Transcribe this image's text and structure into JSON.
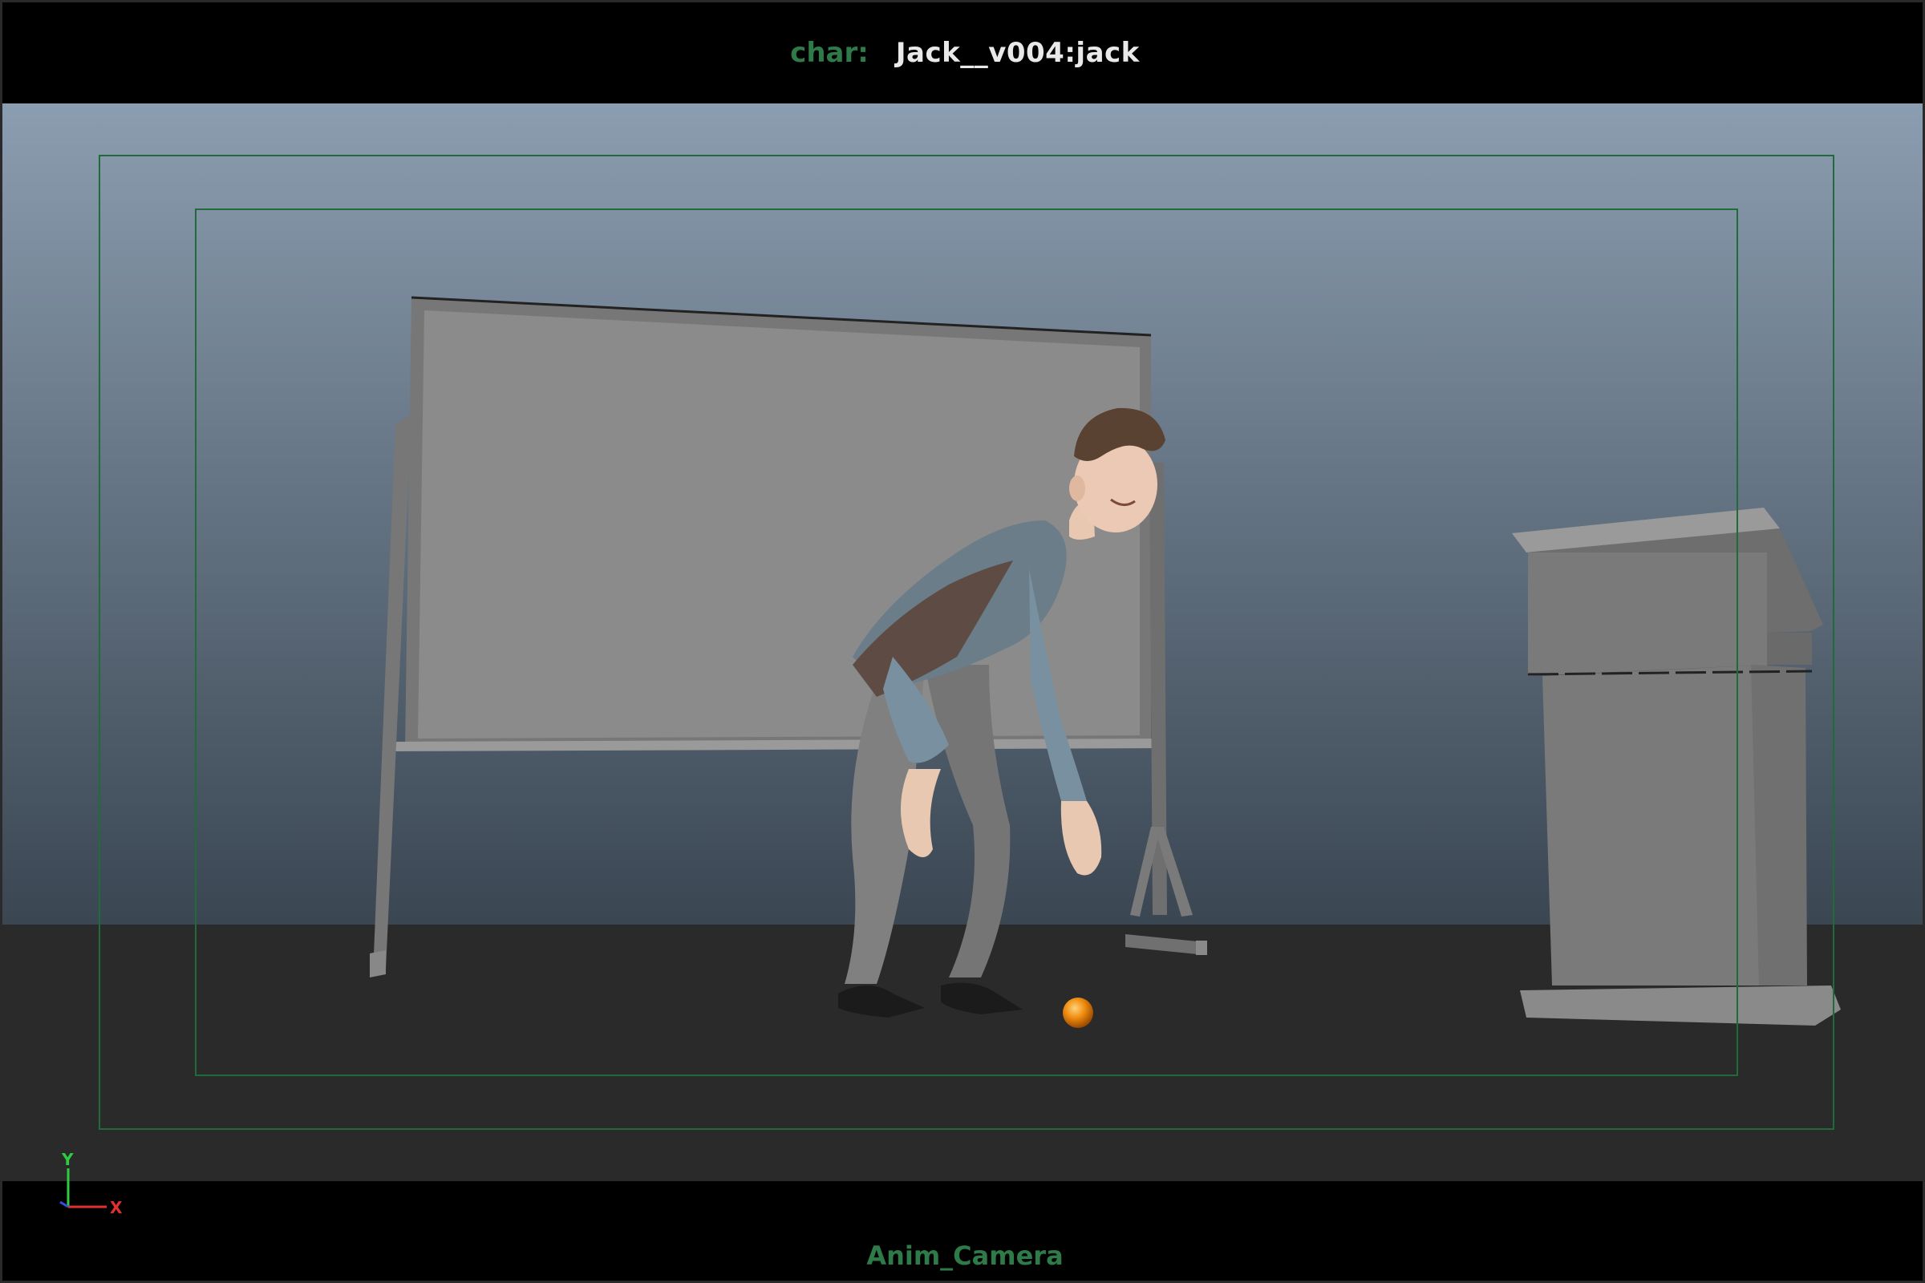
{
  "hud": {
    "object_label": "char:",
    "object_value": "Jack__v004:jack",
    "camera_name": "Anim_Camera"
  },
  "axis_gizmo": {
    "y_label": "Y",
    "x_label": "X",
    "y_color": "#2ecc40",
    "x_color": "#e23030",
    "z_color": "#3050e0"
  },
  "colors": {
    "background_top": "#8b9db0",
    "background_bottom": "#3a4652",
    "floor": "#2a2a2a",
    "gate_lines": "#1f6b3a",
    "hud_label": "#2e7a48",
    "ball": "#f08c10"
  },
  "scene": {
    "objects": [
      "whiteboard",
      "character-jack",
      "ball",
      "podium"
    ]
  }
}
